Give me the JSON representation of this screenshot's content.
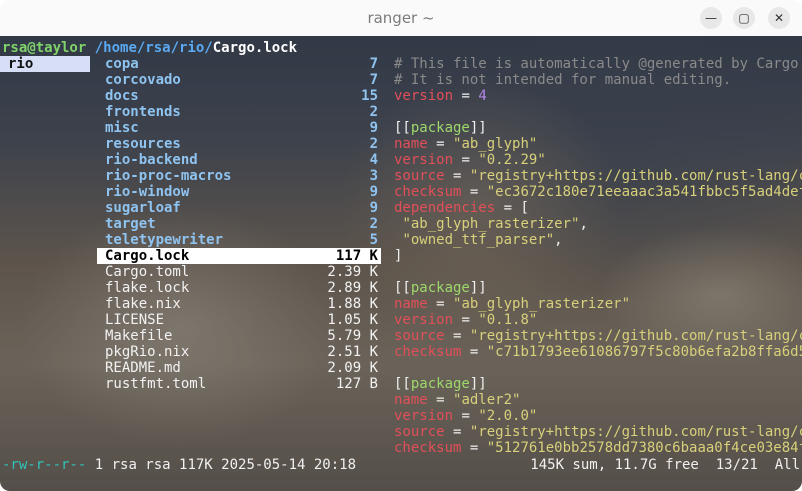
{
  "window": {
    "title": "ranger ~",
    "minimize_label": "—",
    "maximize_label": "▢",
    "close_label": "✕"
  },
  "header": {
    "user_host": "rsa@taylor",
    "path": "/home/rsa/rio/",
    "file": "Cargo.lock"
  },
  "parent_dir": {
    "selected": "rio"
  },
  "entries": [
    {
      "name": "copa",
      "size": "7",
      "type": "dir"
    },
    {
      "name": "corcovado",
      "size": "7",
      "type": "dir"
    },
    {
      "name": "docs",
      "size": "15",
      "type": "dir"
    },
    {
      "name": "frontends",
      "size": "2",
      "type": "dir"
    },
    {
      "name": "misc",
      "size": "9",
      "type": "dir"
    },
    {
      "name": "resources",
      "size": "2",
      "type": "dir"
    },
    {
      "name": "rio-backend",
      "size": "4",
      "type": "dir"
    },
    {
      "name": "rio-proc-macros",
      "size": "3",
      "type": "dir"
    },
    {
      "name": "rio-window",
      "size": "9",
      "type": "dir"
    },
    {
      "name": "sugarloaf",
      "size": "9",
      "type": "dir"
    },
    {
      "name": "target",
      "size": "2",
      "type": "dir"
    },
    {
      "name": "teletypewriter",
      "size": "5",
      "type": "dir"
    },
    {
      "name": "Cargo.lock",
      "size": "117 K",
      "type": "selected"
    },
    {
      "name": "Cargo.toml",
      "size": "2.39 K",
      "type": "file"
    },
    {
      "name": "flake.lock",
      "size": "2.89 K",
      "type": "file"
    },
    {
      "name": "flake.nix",
      "size": "1.88 K",
      "type": "file"
    },
    {
      "name": "LICENSE",
      "size": "1.05 K",
      "type": "file"
    },
    {
      "name": "Makefile",
      "size": "5.79 K",
      "type": "file"
    },
    {
      "name": "pkgRio.nix",
      "size": "2.51 K",
      "type": "file"
    },
    {
      "name": "README.md",
      "size": "2.09 K",
      "type": "file"
    },
    {
      "name": "rustfmt.toml",
      "size": "127 B",
      "type": "file"
    }
  ],
  "preview": [
    [
      [
        "cmt",
        "# This file is automatically @generated by Cargo."
      ]
    ],
    [
      [
        "cmt",
        "# It is not intended for manual editing."
      ]
    ],
    [
      [
        "key",
        "version"
      ],
      [
        "txt",
        " = "
      ],
      [
        "num",
        "4"
      ]
    ],
    [],
    [
      [
        "txt",
        "[["
      ],
      [
        "pk",
        "package"
      ],
      [
        "txt",
        "]]"
      ]
    ],
    [
      [
        "key",
        "name"
      ],
      [
        "txt",
        " = "
      ],
      [
        "str",
        "\"ab_glyph\""
      ]
    ],
    [
      [
        "key",
        "version"
      ],
      [
        "txt",
        " = "
      ],
      [
        "str",
        "\"0.2.29\""
      ]
    ],
    [
      [
        "key",
        "source"
      ],
      [
        "txt",
        " = "
      ],
      [
        "str",
        "\"registry+https://github.com/rust-lang/cra"
      ]
    ],
    [
      [
        "key",
        "checksum"
      ],
      [
        "txt",
        " = "
      ],
      [
        "str",
        "\"ec3672c180e71eeaaac3a541fbbc5f5ad4def8b"
      ]
    ],
    [
      [
        "key",
        "dependencies"
      ],
      [
        "txt",
        " = ["
      ]
    ],
    [
      [
        "txt",
        " "
      ],
      [
        "str",
        "\"ab_glyph_rasterizer\""
      ],
      [
        "txt",
        ","
      ]
    ],
    [
      [
        "txt",
        " "
      ],
      [
        "str",
        "\"owned_ttf_parser\""
      ],
      [
        "txt",
        ","
      ]
    ],
    [
      [
        "txt",
        "]"
      ]
    ],
    [],
    [
      [
        "txt",
        "[["
      ],
      [
        "pk",
        "package"
      ],
      [
        "txt",
        "]]"
      ]
    ],
    [
      [
        "key",
        "name"
      ],
      [
        "txt",
        " = "
      ],
      [
        "str",
        "\"ab_glyph_rasterizer\""
      ]
    ],
    [
      [
        "key",
        "version"
      ],
      [
        "txt",
        " = "
      ],
      [
        "str",
        "\"0.1.8\""
      ]
    ],
    [
      [
        "key",
        "source"
      ],
      [
        "txt",
        " = "
      ],
      [
        "str",
        "\"registry+https://github.com/rust-lang/cra"
      ]
    ],
    [
      [
        "key",
        "checksum"
      ],
      [
        "txt",
        " = "
      ],
      [
        "str",
        "\"c71b1793ee61086797f5c80b6efa2b8ffa6d5dd"
      ]
    ],
    [],
    [
      [
        "txt",
        "[["
      ],
      [
        "pk",
        "package"
      ],
      [
        "txt",
        "]]"
      ]
    ],
    [
      [
        "key",
        "name"
      ],
      [
        "txt",
        " = "
      ],
      [
        "str",
        "\"adler2\""
      ]
    ],
    [
      [
        "key",
        "version"
      ],
      [
        "txt",
        " = "
      ],
      [
        "str",
        "\"2.0.0\""
      ]
    ],
    [
      [
        "key",
        "source"
      ],
      [
        "txt",
        " = "
      ],
      [
        "str",
        "\"registry+https://github.com/rust-lang/cra"
      ]
    ],
    [
      [
        "key",
        "checksum"
      ],
      [
        "txt",
        " = "
      ],
      [
        "str",
        "\"512761e0bb2578dd7380c6baaa0f4ce03e84f95"
      ]
    ]
  ],
  "statusbar": {
    "permissions": "-rw-r--r--",
    "info": " 1 rsa rsa 117K 2025-05-14 20:18",
    "summary": "145K sum, 11.7G free  13/21  All"
  }
}
